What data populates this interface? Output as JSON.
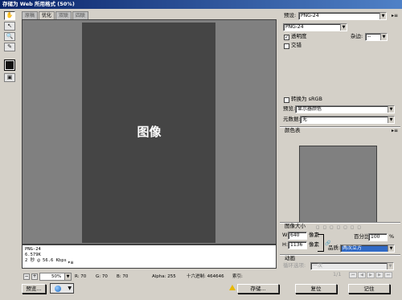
{
  "window": {
    "title": "存储为 Web 所用格式 (50%)"
  },
  "tabs": [
    "原稿",
    "优化",
    "双联",
    "四联"
  ],
  "preview": {
    "image_label": "图像"
  },
  "info": {
    "line1": "PNG-24",
    "line2": "6.579K",
    "line3": "2 秒 @ 56.6 Kbps",
    "menu_glyph": "▾≡"
  },
  "statusbar": {
    "zoom": "50%",
    "r": "R: 70",
    "g": "G: 70",
    "b": "B: 70",
    "alpha": "Alpha: 255",
    "hex": "十六进制: 464646",
    "index": "索引:"
  },
  "buttons": {
    "preview": "预览...",
    "save": "存储...",
    "reset": "复位",
    "remember": "记住"
  },
  "settings": {
    "preset_label": "预设:",
    "preset_value": "PNG-24",
    "format_value": "PNG-24",
    "transparency_label": "透明度",
    "transparency_checked": true,
    "interlaced_label": "交错",
    "interlaced_checked": false,
    "matte_label": "杂边:",
    "matte_value": "--",
    "convert_label": "转换为 sRGB",
    "preview_label": "预览:",
    "preview_value": "显示器颜色",
    "metadata_label": "元数据:",
    "metadata_value": "无",
    "color_table_label": "颜色表"
  },
  "image_size": {
    "title": "图像大小",
    "w_label": "W:",
    "w_value": "640",
    "w_unit": "像素",
    "h_label": "H:",
    "h_value": "1136",
    "h_unit": "像素",
    "percent_label": "百分比:",
    "percent_value": "100",
    "percent_unit": "%",
    "quality_label": "品质:",
    "quality_value": "两次立方"
  },
  "animation": {
    "title": "动画",
    "loop_label": "循环选项:",
    "loop_value": "一次",
    "frame": "1/1"
  },
  "colors": {
    "preview_bg": "#808080",
    "image": "#454545",
    "quality_hl": "#316ac5"
  }
}
